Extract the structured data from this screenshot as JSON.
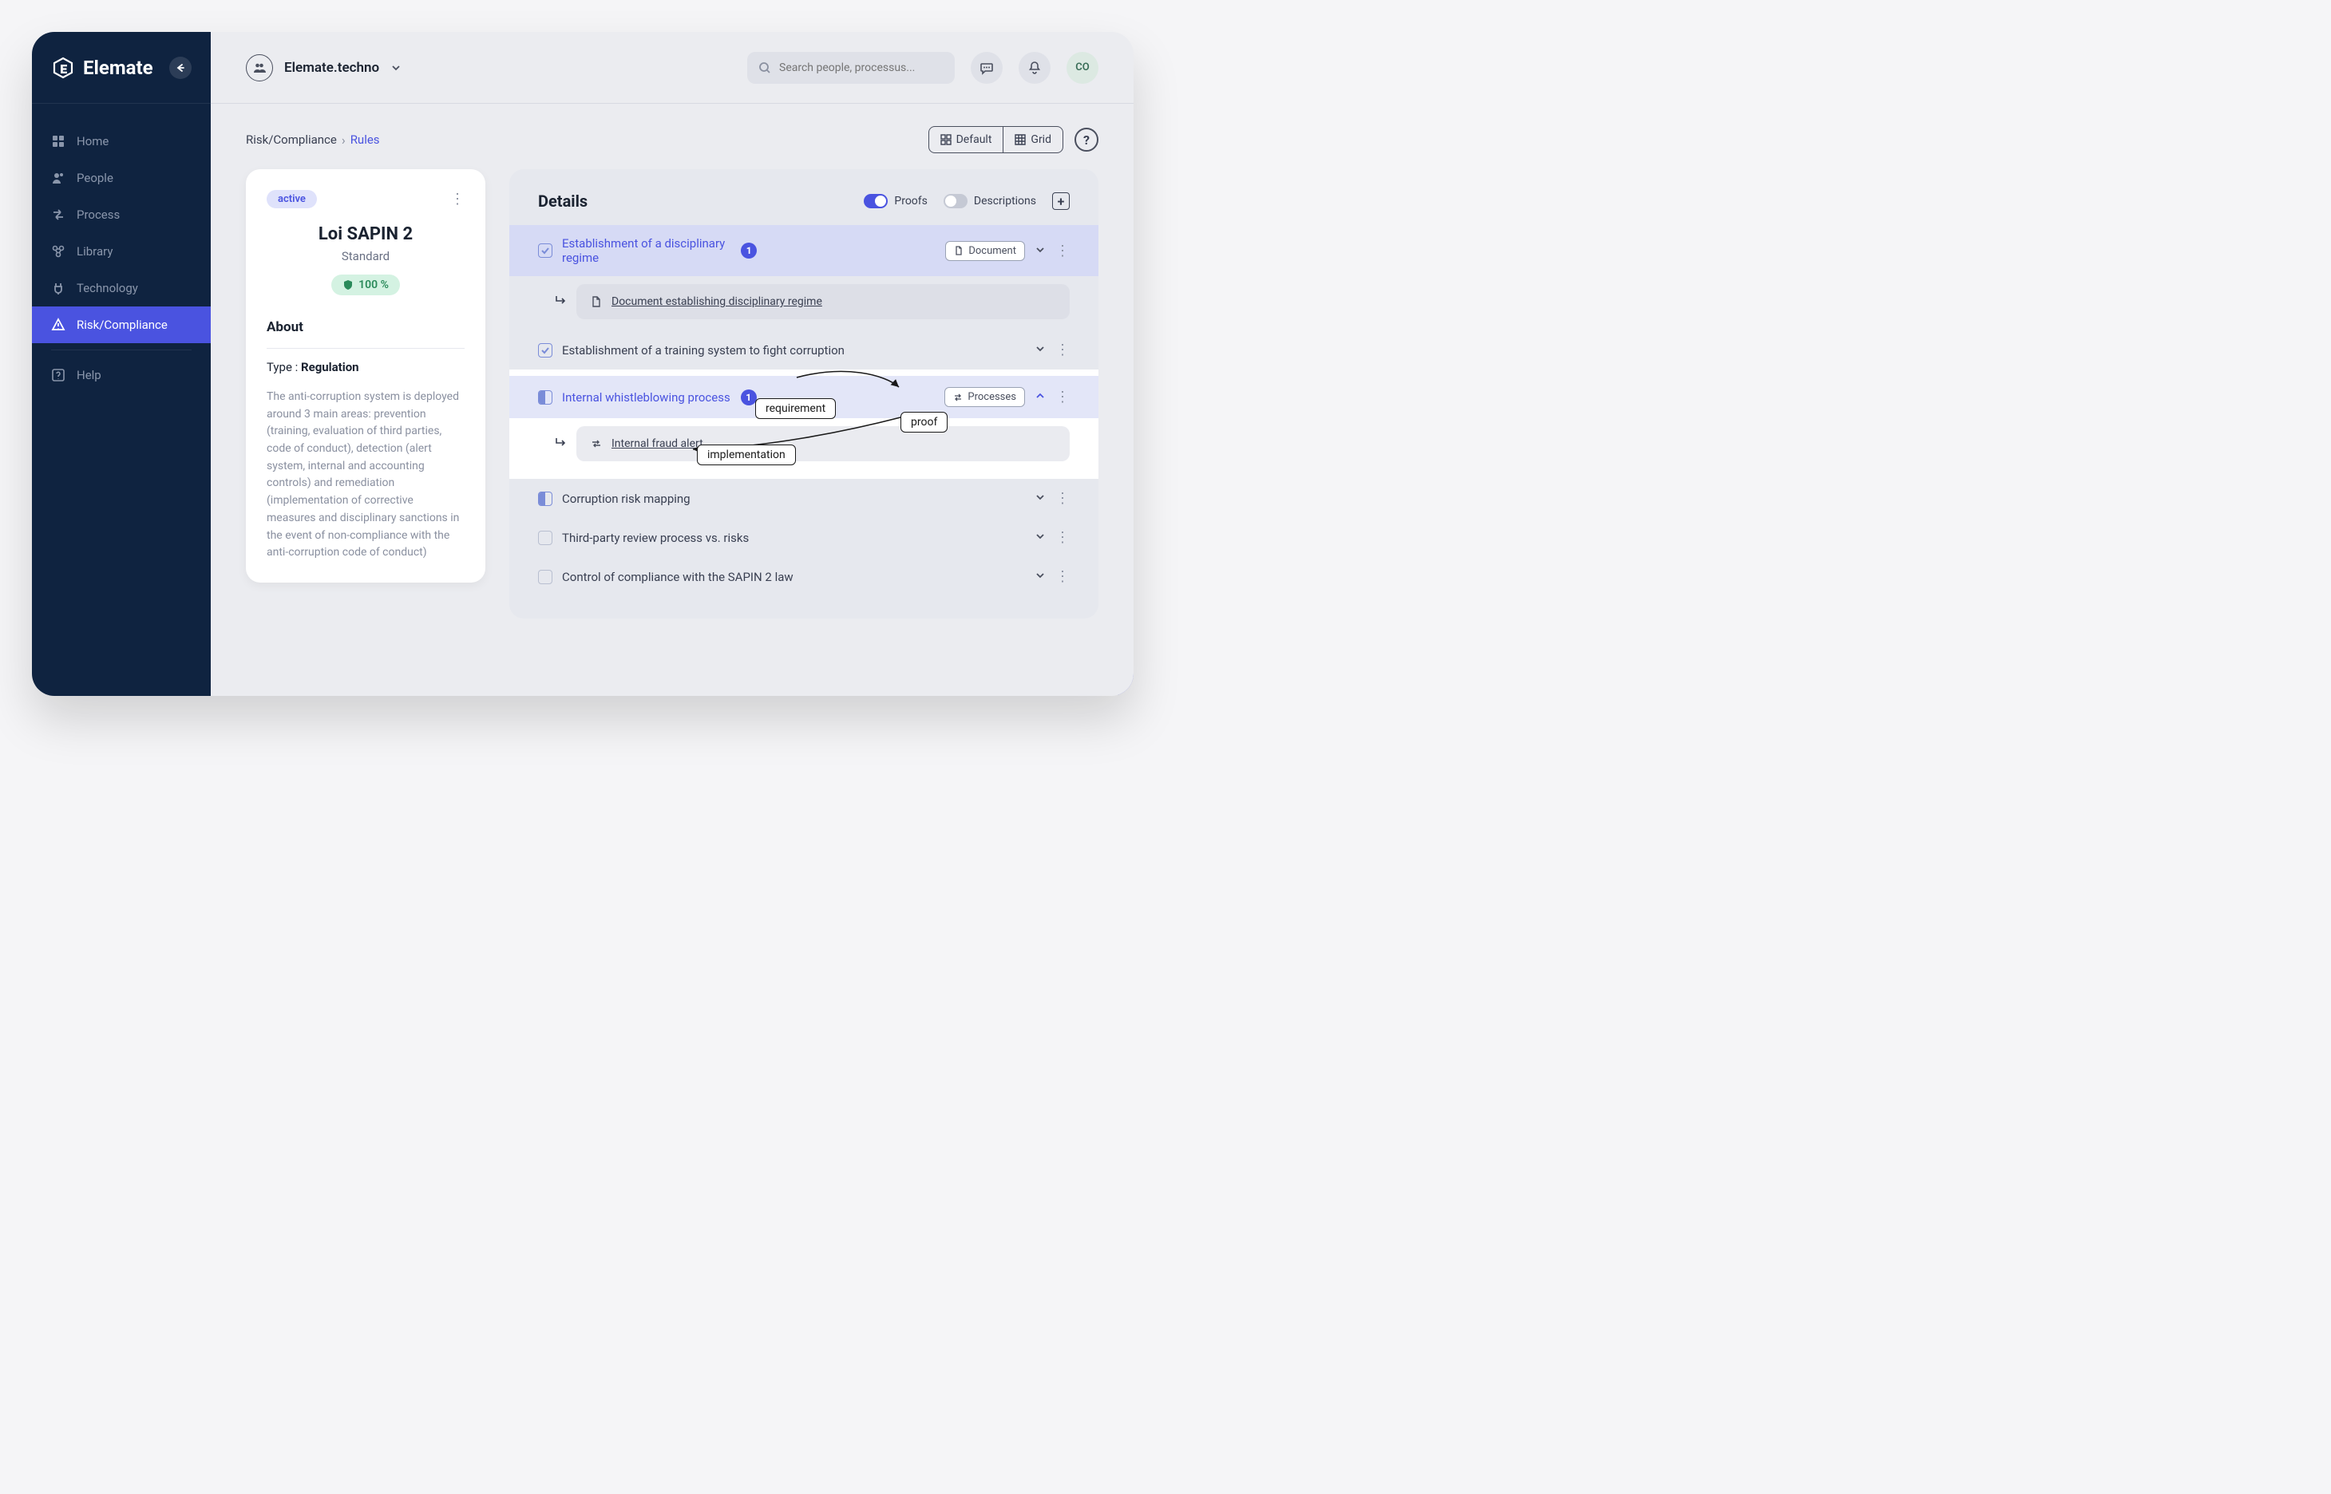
{
  "brand": "Elemate",
  "sidebar": {
    "items": [
      {
        "label": "Home"
      },
      {
        "label": "People"
      },
      {
        "label": "Process"
      },
      {
        "label": "Library"
      },
      {
        "label": "Technology"
      },
      {
        "label": "Risk/Compliance"
      }
    ],
    "help": "Help"
  },
  "topbar": {
    "org_name": "Elemate.techno",
    "search_placeholder": "Search people, processus...",
    "avatar_initials": "CO"
  },
  "breadcrumb": {
    "root": "Risk/Compliance",
    "current": "Rules"
  },
  "view_toggle": {
    "default": "Default",
    "grid": "Grid"
  },
  "rule_card": {
    "status": "active",
    "title": "Loi SAPIN 2",
    "subtitle": "Standard",
    "percent": "100 %",
    "about_title": "About",
    "type_label": "Type : ",
    "type_value": "Regulation",
    "about_text": "The anti-corruption system is deployed around 3 main areas: prevention (training, evaluation of third parties, code of conduct), detection (alert system, internal and accounting controls) and remediation (implementation of corrective measures and disciplinary sanctions in the event of non-compliance with the anti-corruption code of conduct)"
  },
  "details": {
    "title": "Details",
    "toggle_proofs": "Proofs",
    "toggle_descriptions": "Descriptions",
    "requirements": [
      {
        "label": "Establishment of a disciplinary regime",
        "count": "1",
        "chip": "Document"
      },
      {
        "label": "Establishment of a training system to fight corruption"
      },
      {
        "label": "Internal whistleblowing process",
        "count": "1",
        "chip": "Processes"
      },
      {
        "label": "Corruption risk mapping"
      },
      {
        "label": "Third-party review process vs. risks"
      },
      {
        "label": "Control of compliance with the SAPIN 2 law"
      }
    ],
    "sub_items": {
      "doc_sub": "Document establishing disciplinary regime",
      "process_sub": "Internal fraud alert"
    }
  },
  "annotations": {
    "requirement": "requirement",
    "proof": "proof",
    "implementation": "implementation"
  }
}
